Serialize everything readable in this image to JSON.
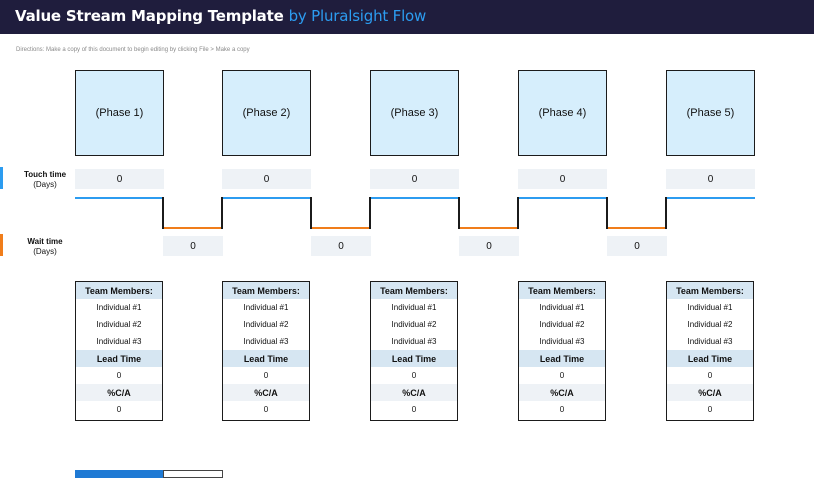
{
  "header": {
    "title": "Value Stream Mapping Template",
    "brand": "by Pluralsight Flow"
  },
  "directions": "Directions: Make a copy of this document to begin editing by clicking File > Make a copy",
  "labels": {
    "touch_title": "Touch time",
    "touch_unit": "(Days)",
    "wait_title": "Wait time",
    "wait_unit": "(Days)"
  },
  "colors": {
    "header_bg": "#1f1d3d",
    "brand": "#2c9cf0",
    "phase_fill": "#d6eefc",
    "touch_line": "#2c9cf0",
    "wait_line": "#f07d1a"
  },
  "phases": [
    {
      "name": "(Phase 1)",
      "touch": "0",
      "wait": "0",
      "team_header": "Team Members:",
      "members": [
        "Individual #1",
        "Individual #2",
        "Individual #3"
      ],
      "lead_time_label": "Lead Time",
      "lead_time": "0",
      "pca_label": "%C/A",
      "pca": "0"
    },
    {
      "name": "(Phase 2)",
      "touch": "0",
      "wait": "0",
      "team_header": "Team Members:",
      "members": [
        "Individual #1",
        "Individual #2",
        "Individual #3"
      ],
      "lead_time_label": "Lead Time",
      "lead_time": "0",
      "pca_label": "%C/A",
      "pca": "0"
    },
    {
      "name": "(Phase 3)",
      "touch": "0",
      "wait": "0",
      "team_header": "Team Members:",
      "members": [
        "Individual #1",
        "Individual #2",
        "Individual #3"
      ],
      "lead_time_label": "Lead Time",
      "lead_time": "0",
      "pca_label": "%C/A",
      "pca": "0"
    },
    {
      "name": "(Phase 4)",
      "touch": "0",
      "wait": "0",
      "team_header": "Team Members:",
      "members": [
        "Individual #1",
        "Individual #2",
        "Individual #3"
      ],
      "lead_time_label": "Lead Time",
      "lead_time": "0",
      "pca_label": "%C/A",
      "pca": "0"
    },
    {
      "name": "(Phase 5)",
      "touch": "0",
      "team_header": "Team Members:",
      "members": [
        "Individual #1",
        "Individual #2",
        "Individual #3"
      ],
      "lead_time_label": "Lead Time",
      "lead_time": "0",
      "pca_label": "%C/A",
      "pca": "0"
    }
  ]
}
